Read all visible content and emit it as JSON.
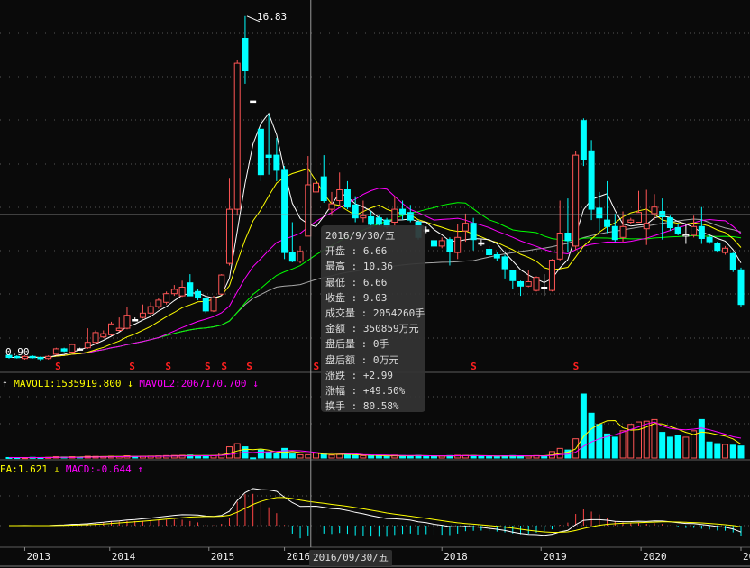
{
  "chart_data": {
    "type": "candlestick",
    "period": "monthly",
    "price_range": [
      0.9,
      17.5
    ],
    "high_label": "16.83",
    "low_label": "0.90",
    "colors": {
      "up": "#ff5555",
      "down": "#00ffff",
      "ma5": "#ffffff",
      "ma10": "#ffff00",
      "ma20": "#ff00ff",
      "ma30": "#00ff00",
      "ma60": "#aaaaaa",
      "background": "#0a0a0a"
    },
    "candles": [
      [
        1.15,
        1.2,
        1.0,
        1.05,
        30
      ],
      [
        1.1,
        1.15,
        1.0,
        1.05,
        25
      ],
      [
        1.0,
        1.15,
        0.95,
        1.1,
        20
      ],
      [
        1.1,
        1.15,
        1.0,
        1.05,
        40
      ],
      [
        1.05,
        1.1,
        0.9,
        1.0,
        30
      ],
      [
        1.0,
        1.15,
        0.95,
        1.1,
        40
      ],
      [
        1.2,
        1.5,
        1.15,
        1.45,
        80
      ],
      [
        1.45,
        1.5,
        1.3,
        1.35,
        60
      ],
      [
        1.3,
        1.7,
        1.3,
        1.65,
        80
      ],
      [
        1.45,
        1.5,
        1.4,
        1.45,
        60
      ],
      [
        1.5,
        2.4,
        1.45,
        1.75,
        110
      ],
      [
        1.75,
        2.3,
        1.7,
        2.2,
        100
      ],
      [
        2.0,
        2.3,
        1.95,
        2.15,
        90
      ],
      [
        2.1,
        2.7,
        2.05,
        2.6,
        110
      ],
      [
        2.3,
        2.9,
        2.25,
        2.4,
        90
      ],
      [
        2.4,
        3.4,
        2.35,
        3.0,
        140
      ],
      [
        2.8,
        2.9,
        2.75,
        2.8,
        90
      ],
      [
        2.9,
        3.5,
        2.85,
        3.1,
        110
      ],
      [
        3.1,
        3.6,
        3.0,
        3.4,
        120
      ],
      [
        3.4,
        3.8,
        3.3,
        3.7,
        130
      ],
      [
        3.6,
        4.1,
        3.5,
        4.0,
        150
      ],
      [
        4.0,
        4.4,
        3.9,
        4.2,
        160
      ],
      [
        3.9,
        4.6,
        3.85,
        4.3,
        170
      ],
      [
        4.5,
        4.9,
        3.9,
        3.9,
        180
      ],
      [
        4.1,
        4.2,
        3.7,
        3.8,
        130
      ],
      [
        3.8,
        3.9,
        3.1,
        3.2,
        150
      ],
      [
        3.2,
        3.9,
        3.15,
        3.8,
        150
      ],
      [
        3.98,
        4.9,
        3.95,
        4.86,
        300
      ],
      [
        5.4,
        9.35,
        5.3,
        7.9,
        700
      ],
      [
        7.9,
        14.8,
        7.6,
        14.65,
        900
      ],
      [
        15.8,
        16.83,
        13.7,
        14.3,
        700
      ],
      [
        12.9,
        12.9,
        12.9,
        12.9,
        10
      ],
      [
        11.6,
        11.8,
        9.2,
        9.5,
        500
      ],
      [
        10.4,
        12.3,
        9.5,
        10.3,
        350
      ],
      [
        10.4,
        11.2,
        9.2,
        9.7,
        300
      ],
      [
        9.7,
        9.9,
        5.6,
        5.9,
        600
      ],
      [
        5.9,
        7.3,
        5.45,
        5.5,
        250
      ],
      [
        5.5,
        6.2,
        5.4,
        5.95,
        200
      ],
      [
        6.66,
        10.36,
        6.66,
        9.03,
        205
      ],
      [
        8.7,
        10.8,
        8.7,
        9.1,
        300
      ],
      [
        9.4,
        10.4,
        8.2,
        8.3,
        250
      ],
      [
        7.9,
        8.7,
        7.6,
        8.15,
        180
      ],
      [
        8.3,
        9.6,
        8.1,
        8.8,
        220
      ],
      [
        8.8,
        9.2,
        7.9,
        8.0,
        200
      ],
      [
        8.1,
        8.5,
        7.3,
        7.5,
        160
      ],
      [
        7.5,
        8.3,
        7.3,
        7.6,
        150
      ],
      [
        7.55,
        7.8,
        7.0,
        7.2,
        130
      ],
      [
        7.5,
        7.6,
        7.1,
        7.2,
        120
      ],
      [
        7.4,
        7.5,
        7.0,
        7.1,
        110
      ],
      [
        7.3,
        8.5,
        7.1,
        7.9,
        180
      ],
      [
        7.9,
        8.3,
        7.4,
        7.65,
        150
      ],
      [
        7.75,
        8.1,
        7.3,
        7.4,
        140
      ],
      [
        7.3,
        7.4,
        6.5,
        6.6,
        160
      ],
      [
        6.95,
        7.1,
        6.8,
        6.95,
        110
      ],
      [
        6.45,
        6.6,
        6.1,
        6.2,
        130
      ],
      [
        6.2,
        6.6,
        6.1,
        6.45,
        120
      ],
      [
        6.5,
        6.6,
        5.3,
        5.95,
        150
      ],
      [
        5.9,
        7.2,
        5.6,
        6.6,
        170
      ],
      [
        6.9,
        7.7,
        6.4,
        7.25,
        160
      ],
      [
        7.25,
        7.5,
        6.0,
        6.5,
        150
      ],
      [
        6.35,
        6.5,
        6.2,
        6.35,
        100
      ],
      [
        6.05,
        6.2,
        5.7,
        5.8,
        120
      ],
      [
        5.8,
        5.9,
        5.5,
        5.65,
        110
      ],
      [
        5.7,
        5.8,
        4.7,
        5.15,
        140
      ],
      [
        5.05,
        5.1,
        4.2,
        4.6,
        150
      ],
      [
        4.55,
        4.6,
        3.9,
        4.35,
        140
      ],
      [
        4.35,
        5.1,
        4.3,
        4.55,
        120
      ],
      [
        4.15,
        4.8,
        4.1,
        4.75,
        150
      ],
      [
        4.3,
        4.9,
        3.9,
        4.3,
        140
      ],
      [
        4.15,
        5.6,
        4.1,
        5.55,
        400
      ],
      [
        5.6,
        8.3,
        5.5,
        6.8,
        600
      ],
      [
        6.8,
        8.4,
        5.9,
        6.45,
        500
      ],
      [
        6.2,
        10.6,
        6.0,
        10.4,
        1200
      ],
      [
        12.0,
        12.1,
        9.9,
        10.2,
        4000
      ],
      [
        10.6,
        11.1,
        7.4,
        7.9,
        2800
      ],
      [
        7.95,
        8.7,
        6.9,
        7.5,
        2100
      ],
      [
        7.4,
        9.2,
        6.8,
        7.1,
        1500
      ],
      [
        7.1,
        7.7,
        6.4,
        6.5,
        1300
      ],
      [
        6.6,
        7.8,
        6.4,
        7.1,
        1700
      ],
      [
        7.3,
        7.5,
        7.2,
        7.4,
        2100
      ],
      [
        7.3,
        8.75,
        7.3,
        7.75,
        2250
      ],
      [
        7.0,
        8.8,
        6.25,
        7.25,
        2300
      ],
      [
        7.7,
        8.6,
        7.4,
        8.0,
        2400
      ],
      [
        7.8,
        8.4,
        6.5,
        7.55,
        1600
      ],
      [
        7.5,
        7.6,
        6.9,
        7.05,
        1300
      ],
      [
        7.05,
        7.2,
        6.7,
        6.8,
        1400
      ],
      [
        6.7,
        7.2,
        6.3,
        6.72,
        1300
      ],
      [
        6.7,
        7.6,
        6.6,
        7.1,
        1700
      ],
      [
        7.1,
        8.0,
        6.3,
        6.55,
        2400
      ],
      [
        6.6,
        6.7,
        6.3,
        6.4,
        1000
      ],
      [
        6.3,
        6.4,
        5.9,
        6.0,
        900
      ],
      [
        5.9,
        6.2,
        5.8,
        6.1,
        850
      ],
      [
        5.85,
        5.9,
        5.0,
        5.1,
        800
      ],
      [
        5.1,
        5.2,
        3.4,
        3.5,
        750
      ]
    ],
    "volume_unit": "万手",
    "x_ticks": [
      {
        "label": "2013",
        "index": 2
      },
      {
        "label": "2014",
        "index": 12.8
      },
      {
        "label": "2015",
        "index": 25.4
      },
      {
        "label": "2016",
        "index": 35
      },
      {
        "label": "2018",
        "index": 55
      },
      {
        "label": "2019",
        "index": 67.6
      },
      {
        "label": "2020",
        "index": 80.3
      },
      {
        "label": "20",
        "index": 93
      }
    ],
    "signal_marks": {
      "label": "S",
      "indices": [
        6.2,
        15.6,
        20.2,
        25.2,
        27.3,
        30.5,
        39,
        59,
        72
      ]
    },
    "crosshair": {
      "index": 38,
      "price": 7.65,
      "date_label": "2016/09/30/五"
    }
  },
  "volume_header": {
    "arrow1": "↑",
    "mavol1": "MAVOL1:1535919.800",
    "arrow2": "↓",
    "mavol2": "MAVOL2:2067170.700",
    "arrow3": "↓"
  },
  "macd_header": {
    "dea": "EA:1.621",
    "arrow1": "↓",
    "macd": "MACD:-0.644",
    "arrow2": "↑"
  },
  "tooltip": {
    "date": "2016/9/30/五",
    "rows": [
      {
        "label": "开盘",
        "value": "6.66"
      },
      {
        "label": "最高",
        "value": "10.36"
      },
      {
        "label": "最低",
        "value": "6.66"
      },
      {
        "label": "收盘",
        "value": "9.03"
      },
      {
        "label": "成交量",
        "value": "2054260手"
      },
      {
        "label": "金额",
        "value": "350859万元"
      },
      {
        "label": "盘后量",
        "value": "0手"
      },
      {
        "label": "盘后额",
        "value": "0万元"
      },
      {
        "label": "涨跌",
        "value": "+2.99"
      },
      {
        "label": "涨幅",
        "value": "+49.50%"
      },
      {
        "label": "换手",
        "value": "80.58%"
      }
    ]
  }
}
